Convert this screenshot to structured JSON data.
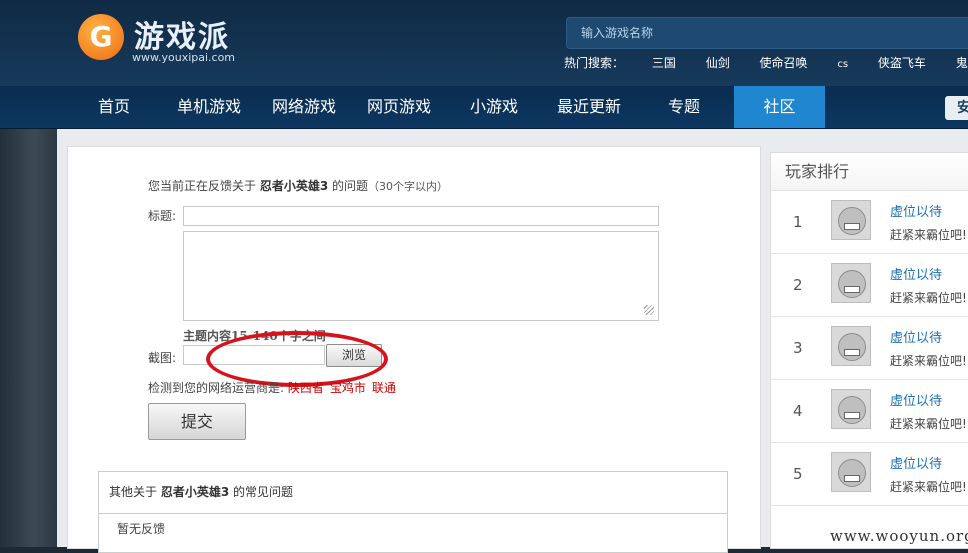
{
  "header": {
    "logo_name": "游戏派",
    "logo_url": "www.youxipai.com",
    "search_placeholder": "输入游戏名称",
    "hot_label": "热门搜索：",
    "hot_items": [
      "三国",
      "仙剑",
      "使命召唤",
      "cs",
      "侠盗飞车",
      "鬼泣"
    ]
  },
  "nav": {
    "items": [
      "首页",
      "单机游戏",
      "网络游戏",
      "网页游戏",
      "小游戏",
      "最近更新",
      "专题",
      "社区"
    ],
    "active": "社区",
    "right_button": "安"
  },
  "form": {
    "intro_prefix": "您当前正在反馈关于",
    "game_name": "忍者小英雄3",
    "intro_suffix": "的问题",
    "intro_limit": "（30个字以内）",
    "title_label": "标题:",
    "content_hint": "主题内容15-140个字之间",
    "screenshot_label": "截图:",
    "browse_label": "浏览",
    "isp_label": "检测到您的网络运营商是:",
    "isp_province": "陕西省",
    "isp_city": "宝鸡市",
    "isp_carrier": "联通",
    "submit_label": "提交"
  },
  "faq": {
    "prefix": "其他关于",
    "game_name": "忍者小英雄3",
    "suffix": "的常见问题",
    "empty_text": "暂无反馈"
  },
  "sidebar": {
    "title": "玩家排行",
    "ranks": [
      {
        "num": "1",
        "name": "虚位以待",
        "desc": "赶紧来霸位吧!"
      },
      {
        "num": "2",
        "name": "虚位以待",
        "desc": "赶紧来霸位吧!"
      },
      {
        "num": "3",
        "name": "虚位以待",
        "desc": "赶紧来霸位吧!"
      },
      {
        "num": "4",
        "name": "虚位以待",
        "desc": "赶紧来霸位吧!"
      },
      {
        "num": "5",
        "name": "虚位以待",
        "desc": "赶紧来霸位吧!"
      }
    ]
  },
  "watermark": "www.wooyun.org",
  "colors": {
    "nav_active": "#1f86cf",
    "link_blue": "#1b6fb5",
    "isp_red": "#cc0000",
    "annotation_red": "#d8121b"
  }
}
